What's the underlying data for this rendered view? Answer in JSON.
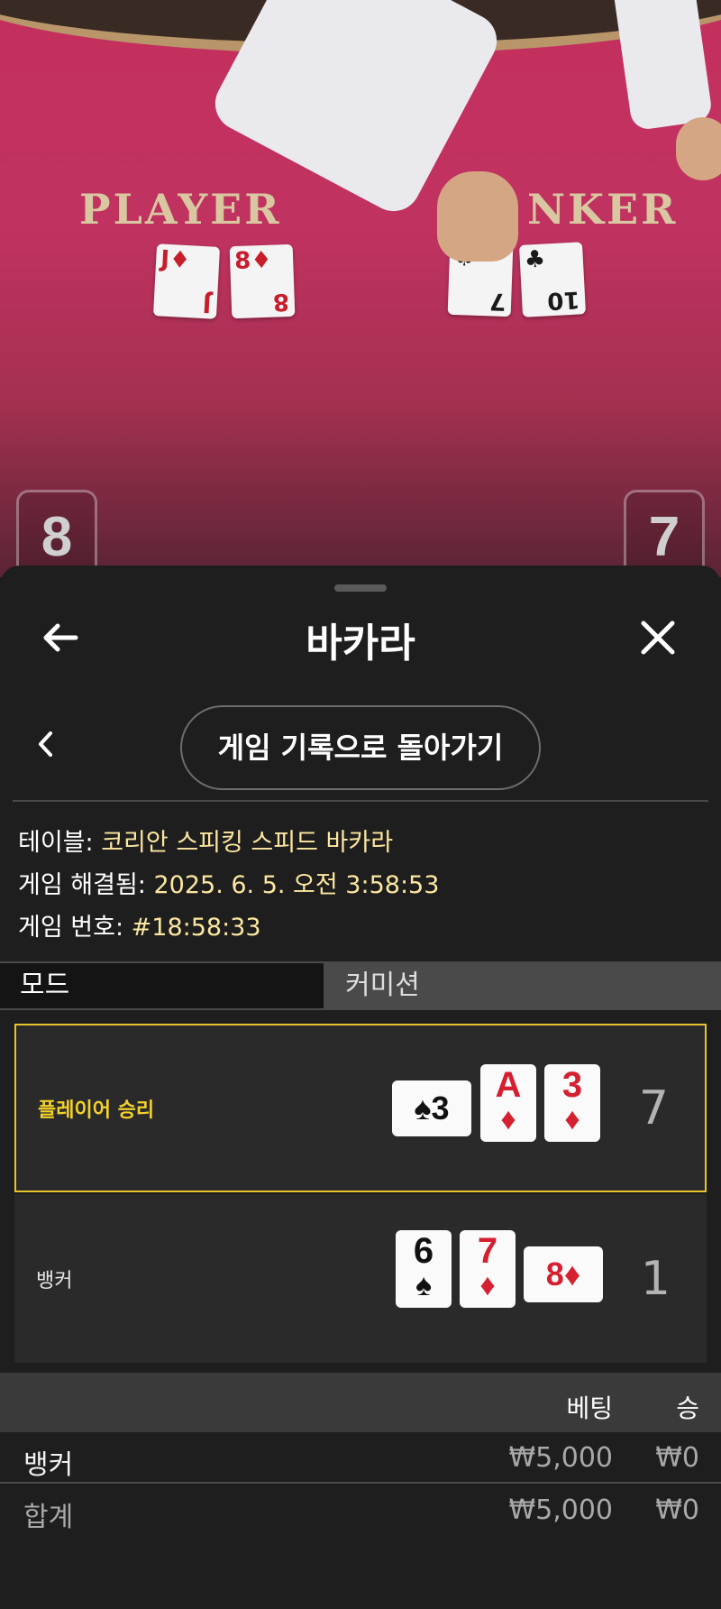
{
  "video": {
    "table_label_player": "PLAYER",
    "table_label_banker": "NKER",
    "player_score": "8",
    "banker_score": "7",
    "table_cards": [
      {
        "rank": "J",
        "suit": "♦"
      },
      {
        "rank": "8",
        "suit": "♦"
      },
      {
        "rank": "7",
        "suit": "♠"
      },
      {
        "rank": "10",
        "suit": "♣"
      }
    ]
  },
  "header": {
    "title": "바카라",
    "back_icon": "arrow-left-icon",
    "close_icon": "close-icon"
  },
  "history": {
    "back_label": "게임 기록으로 돌아가기",
    "chevron_icon": "chevron-left-icon"
  },
  "info": {
    "table_label": "테이블:",
    "table_value": "코리안 스피킹 스피드 바카라",
    "resolved_label": "게임 해결됨:",
    "resolved_value": "2025. 6. 5. 오전 3:58:53",
    "game_no_label": "게임 번호:",
    "game_no_value": "#18:58:33"
  },
  "tabs": {
    "mode": "모드",
    "commission": "커미션"
  },
  "results": {
    "player": {
      "label": "플레이어 승리",
      "total": "7",
      "cards": [
        {
          "rank": "3",
          "suit": "♠",
          "orientation": "sideways"
        },
        {
          "rank": "A",
          "suit": "♦",
          "orientation": "upright"
        },
        {
          "rank": "3",
          "suit": "♦",
          "orientation": "upright"
        }
      ],
      "highlight_color": "#e8c42a"
    },
    "banker": {
      "label": "뱅커",
      "total": "1",
      "cards": [
        {
          "rank": "6",
          "suit": "♠",
          "orientation": "upright"
        },
        {
          "rank": "7",
          "suit": "♦",
          "orientation": "upright"
        },
        {
          "rank": "8",
          "suit": "♦",
          "orientation": "sideways"
        }
      ]
    }
  },
  "bets": {
    "header_bet": "베팅",
    "header_win": "승",
    "rows": [
      {
        "label": "뱅커",
        "bet": "₩5,000",
        "win": "₩0"
      },
      {
        "label": "합계",
        "bet": "₩5,000",
        "win": "₩0"
      }
    ]
  },
  "colors": {
    "accent_gold": "#e8c42a",
    "info_value": "#fce7a0",
    "card_red": "#d42030"
  }
}
